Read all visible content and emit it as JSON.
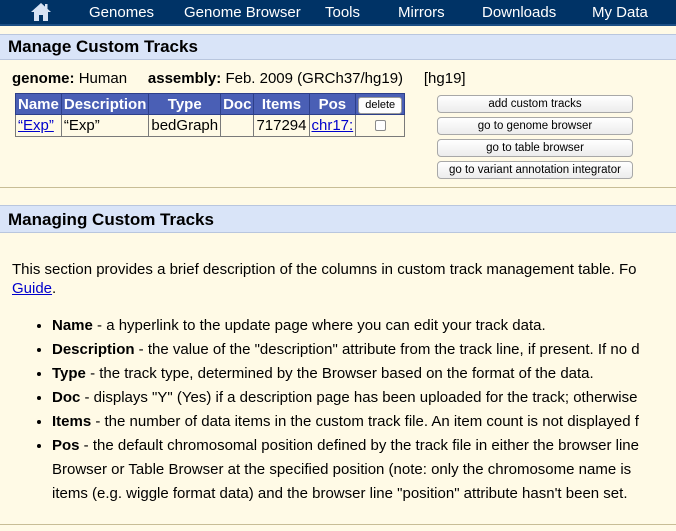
{
  "nav": {
    "home_icon": "home-icon",
    "items": [
      "Genomes",
      "Genome Browser",
      "Tools",
      "Mirrors",
      "Downloads",
      "My Data"
    ]
  },
  "manage": {
    "title": "Manage Custom Tracks",
    "genome_label": "genome:",
    "genome_value": "Human",
    "assembly_label": "assembly:",
    "assembly_value": "Feb. 2009 (GRCh37/hg19)",
    "db": "[hg19]"
  },
  "table": {
    "headers": {
      "name": "Name",
      "description": "Description",
      "type": "Type",
      "doc": "Doc",
      "items": "Items",
      "pos": "Pos",
      "delete": "delete"
    },
    "row": {
      "name": "“Exp”",
      "description": "“Exp”",
      "type": "bedGraph",
      "doc": "",
      "items": "717294",
      "pos": "chr17:"
    }
  },
  "buttons": {
    "add": "add custom tracks",
    "genome_browser": "go to genome browser",
    "table_browser": "go to table browser",
    "variant": "go to variant annotation integrator"
  },
  "managing": {
    "title": "Managing Custom Tracks",
    "intro": "This section provides a brief description of the columns in custom track management table. Fo",
    "guide_link": "Guide",
    "guide_after": ".",
    "items": [
      {
        "term": "Name",
        "text": " - a hyperlink to the update page where you can edit your track data."
      },
      {
        "term": "Description",
        "text": " - the value of the \"description\" attribute from the track line, if present. If no d"
      },
      {
        "term": "Type",
        "text": " - the track type, determined by the Browser based on the format of the data."
      },
      {
        "term": "Doc",
        "text": " - displays \"Y\" (Yes) if a description page has been uploaded for the track; otherwise"
      },
      {
        "term": "Items",
        "text": " - the number of data items in the custom track file. An item count is not displayed f"
      },
      {
        "term": "Pos",
        "text": " - the default chromosomal position defined by the track file in either the browser line"
      }
    ],
    "pos_cont_1": "Browser or Table Browser at the specified position (note: only the chromosome name is",
    "pos_cont_2": "items (e.g. wiggle format data) and the browser line \"position\" attribute hasn't been set."
  }
}
